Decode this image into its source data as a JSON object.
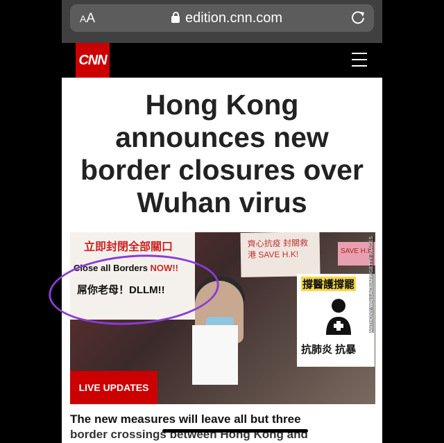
{
  "browser": {
    "text_size_label": "AA",
    "url": "edition.cnn.com"
  },
  "site": {
    "logo": "CNN"
  },
  "article": {
    "headline_lines": [
      "Hong Kong",
      "announces new",
      "border closures over",
      "Wuhan virus"
    ],
    "live_badge": "LIVE UPDATES",
    "subtext_line1": "The new measures will leave all but three",
    "subtext_line2": "border crossings between Hong Kong and"
  },
  "photo": {
    "sign1_title": "立即封閉全部關口",
    "sign1_en_prefix": "Close all Borders ",
    "sign1_en_now": "NOW!!",
    "sign1_line3": "屌你老母！DLLM!!",
    "sign2_text": "齊心抗疫 封關救港 SAVE H.K!",
    "sign3_top": "撐醫護撐罷",
    "sign3_bottom": "抗肺炎 抗暴",
    "pink_sign": "SAVE H.K",
    "credit": "ANTHONY WALLACE/AFP/GETTY IMAGES"
  },
  "colors": {
    "brand_red": "#cc0000",
    "annotation_purple": "#8b3bd8"
  },
  "icons": {
    "lock": "lock-icon",
    "reload": "reload-icon",
    "menu": "hamburger-menu-icon"
  }
}
